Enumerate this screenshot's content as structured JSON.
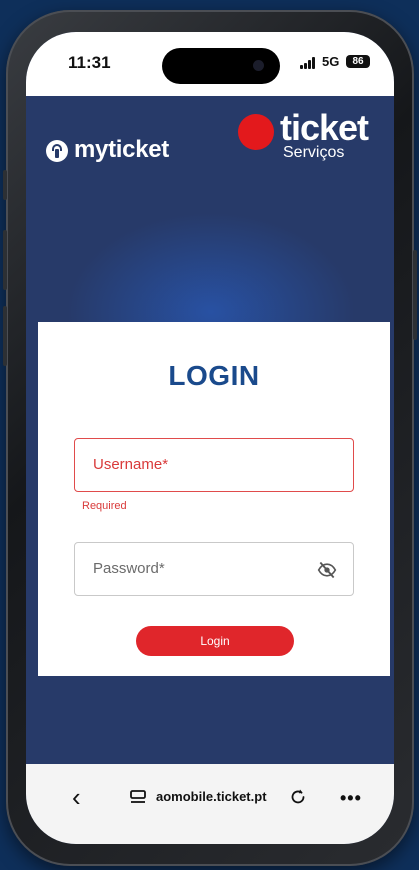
{
  "status_bar": {
    "time": "11:31",
    "network": "5G",
    "battery": "86"
  },
  "header": {
    "myticket_logo": "myticket",
    "ticket_logo": "ticket",
    "ticket_sub": "Serviços"
  },
  "login": {
    "title": "LOGIN",
    "username_placeholder": "Username*",
    "username_error": "Required",
    "password_placeholder": "Password*",
    "submit_label": "Login"
  },
  "browser": {
    "url": "aomobile.ticket.pt",
    "icons": [
      "chevron-left-icon",
      "tab-icon",
      "reload-icon",
      "more-icon"
    ]
  },
  "colors": {
    "background": "#273a69",
    "accent_red": "#e0262b",
    "title_blue": "#1a4a8c"
  }
}
